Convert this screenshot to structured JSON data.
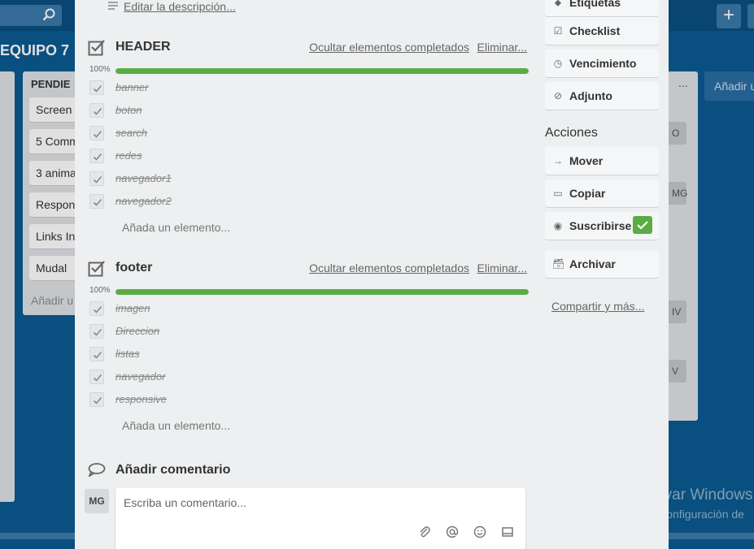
{
  "board": {
    "title": "EQUIPO 7",
    "plus_label": "+",
    "add_list_label": "Añadir u",
    "list_title": "PENDIE",
    "list_dots": "...",
    "cards": [
      "Screen",
      "5 Comm",
      "3 anima",
      "Respon",
      "Links In",
      "Mudal"
    ],
    "add_card_label": "Añadir u",
    "right_badges": [
      "O",
      "MG",
      "IV",
      "V"
    ]
  },
  "description": {
    "edit_label": "Editar la descripción..."
  },
  "checklists": [
    {
      "title": "HEADER",
      "hide_label": "Ocultar elementos completados",
      "delete_label": "Eliminar...",
      "progress_label": "100%",
      "progress": 1.0,
      "items": [
        "banner",
        "boton",
        "search",
        "redes",
        "navegador1",
        "navegador2"
      ],
      "add_item_label": "Añada un elemento..."
    },
    {
      "title": "footer",
      "hide_label": "Ocultar elementos completados",
      "delete_label": "Eliminar...",
      "progress_label": "100%",
      "progress": 1.0,
      "items": [
        "imagen",
        "Direccion",
        "listas",
        "navegador",
        "responsive"
      ],
      "add_item_label": "Añada un elemento..."
    }
  ],
  "comment": {
    "title": "Añadir comentario",
    "avatar_initials": "MG",
    "placeholder": "Escriba un comentario...",
    "tools": [
      "paperclip-icon",
      "at-icon",
      "emoji-icon",
      "card-icon"
    ]
  },
  "sidebar": {
    "add_buttons": [
      {
        "label": "Etiquetas",
        "icon": "tag-icon"
      },
      {
        "label": "Checklist",
        "icon": "checklist-icon"
      },
      {
        "label": "Vencimiento",
        "icon": "clock-icon"
      },
      {
        "label": "Adjunto",
        "icon": "paperclip-icon"
      }
    ],
    "actions_heading": "Acciones",
    "actions": [
      {
        "label": "Mover",
        "icon": "arrow-right-icon"
      },
      {
        "label": "Copiar",
        "icon": "copy-icon"
      },
      {
        "label": "Suscribirse",
        "icon": "eye-icon"
      },
      {
        "label": "Archivar",
        "icon": "archive-icon"
      }
    ],
    "share_label": "Compartir y más..."
  },
  "windows_watermark": {
    "line1": "Activar Windows",
    "line2": "Ir a Configuración de"
  },
  "colors": {
    "board_bg": "#0b5a91",
    "modal_bg": "#edeff0",
    "progress_green": "#5aac44"
  }
}
